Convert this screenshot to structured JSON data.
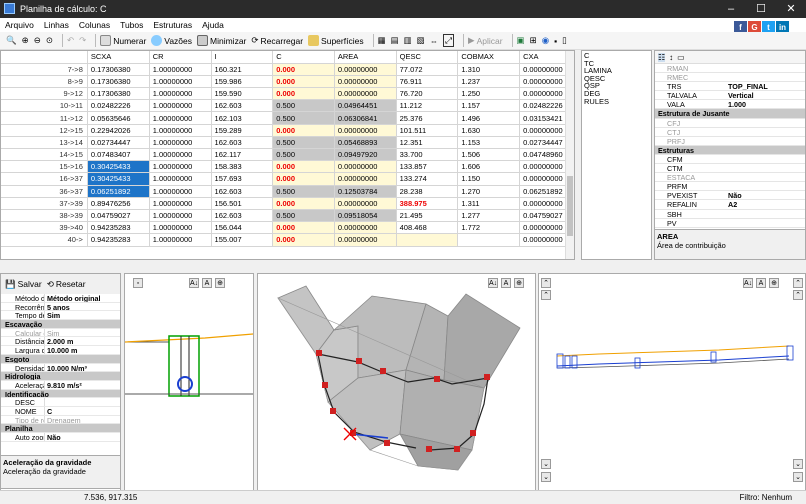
{
  "window": {
    "title": "Planilha de cálculo: C"
  },
  "menu": [
    "Arquivo",
    "Linhas",
    "Colunas",
    "Tubos",
    "Estruturas",
    "Ajuda"
  ],
  "toolbar": {
    "numerar": "Numerar",
    "vazoes": "Vazões",
    "minimizar": "Minimizar",
    "recarregar": "Recarregar",
    "superficies": "Superfícies",
    "aplicar": "Aplicar"
  },
  "grid": {
    "columns": [
      "SCXA",
      "CR",
      "I",
      "C",
      "AREA",
      "QESC",
      "COBMAX",
      "CXA"
    ],
    "rows": [
      {
        "id": "7->8",
        "scxa": "0.17306380",
        "cr": "1.00000000",
        "i": "160.321",
        "c": "0.000",
        "area": "0.00000000",
        "qesc": "77.072",
        "cobmax": "1.310",
        "cxa": "0.00000000"
      },
      {
        "id": "8->9",
        "scxa": "0.17306380",
        "cr": "1.00000000",
        "i": "159.986",
        "c": "0.000",
        "area": "0.00000000",
        "qesc": "76.911",
        "cobmax": "1.237",
        "cxa": "0.00000000"
      },
      {
        "id": "9->12",
        "scxa": "0.17306380",
        "cr": "1.00000000",
        "i": "159.590",
        "c": "0.000",
        "area": "0.00000000",
        "qesc": "76.720",
        "cobmax": "1.250",
        "cxa": "0.00000000"
      },
      {
        "id": "10->11",
        "scxa": "0.02482226",
        "cr": "1.00000000",
        "i": "162.603",
        "c": "0.500",
        "area": "0.04964451",
        "qesc": "11.212",
        "cobmax": "1.157",
        "cxa": "0.02482226"
      },
      {
        "id": "11->12",
        "scxa": "0.05635646",
        "cr": "1.00000000",
        "i": "162.103",
        "c": "0.500",
        "area": "0.06306841",
        "qesc": "25.376",
        "cobmax": "1.496",
        "cxa": "0.03153421"
      },
      {
        "id": "12->15",
        "scxa": "0.22942026",
        "cr": "1.00000000",
        "i": "159.289",
        "c": "0.000",
        "area": "0.00000000",
        "qesc": "101.511",
        "cobmax": "1.630",
        "cxa": "0.00000000"
      },
      {
        "id": "13->14",
        "scxa": "0.02734447",
        "cr": "1.00000000",
        "i": "162.603",
        "c": "0.500",
        "area": "0.05468893",
        "qesc": "12.351",
        "cobmax": "1.153",
        "cxa": "0.02734447"
      },
      {
        "id": "14->15",
        "scxa": "0.07483407",
        "cr": "1.00000000",
        "i": "162.117",
        "c": "0.500",
        "area": "0.09497920",
        "qesc": "33.700",
        "cobmax": "1.506",
        "cxa": "0.04748960"
      },
      {
        "id": "15->16",
        "scxa": "0.30425433",
        "cr": "1.00000000",
        "i": "158.383",
        "c": "0.000",
        "area": "0.00000000",
        "qesc": "133.857",
        "cobmax": "1.606",
        "cxa": "0.00000000"
      },
      {
        "id": "16->37",
        "scxa": "0.30425433",
        "cr": "1.00000000",
        "i": "157.693",
        "c": "0.000",
        "area": "0.00000000",
        "qesc": "133.274",
        "cobmax": "1.150",
        "cxa": "0.00000000"
      },
      {
        "id": "36->37",
        "scxa": "0.06251892",
        "cr": "1.00000000",
        "i": "162.603",
        "c": "0.500",
        "area": "0.12503784",
        "qesc": "28.238",
        "cobmax": "1.270",
        "cxa": "0.06251892"
      },
      {
        "id": "37->39",
        "scxa": "0.89476256",
        "cr": "1.00000000",
        "i": "156.501",
        "c": "0.000",
        "area": "0.00000000",
        "qesc": "388.975",
        "cobmax": "1.311",
        "cxa": "0.00000000"
      },
      {
        "id": "38->39",
        "scxa": "0.04759027",
        "cr": "1.00000000",
        "i": "162.603",
        "c": "0.500",
        "area": "0.09518054",
        "qesc": "21.495",
        "cobmax": "1.277",
        "cxa": "0.04759027"
      },
      {
        "id": "39->40",
        "scxa": "0.94235283",
        "cr": "1.00000000",
        "i": "156.044",
        "c": "0.000",
        "area": "0.00000000",
        "qesc": "408.468",
        "cobmax": "1.772",
        "cxa": "0.00000000"
      },
      {
        "id": "40->",
        "scxa": "0.94235283",
        "cr": "1.00000000",
        "i": "155.007",
        "c": "0.000",
        "area": "0.00000000",
        "qesc": "",
        "cobmax": "",
        "cxa": "0.00000000"
      }
    ]
  },
  "listbox": [
    "C",
    "TC",
    "LAMINA",
    "QESC",
    "QSP",
    "DEG",
    "RULES"
  ],
  "props": {
    "rows": [
      {
        "k": "RMAN",
        "v": "",
        "dim": true
      },
      {
        "k": "RMEC",
        "v": "",
        "dim": true
      },
      {
        "k": "TRS",
        "v": "TOP_FINAL"
      },
      {
        "k": "TALVALA",
        "v": "Vertical"
      },
      {
        "k": "VALA",
        "v": "1.000"
      },
      {
        "cat": "Estrutura de Jusante"
      },
      {
        "k": "CFJ",
        "v": "",
        "dim": true
      },
      {
        "k": "CTJ",
        "v": "",
        "dim": true
      },
      {
        "k": "PRFJ",
        "v": "",
        "dim": true
      },
      {
        "cat": "Estruturas"
      },
      {
        "k": "CFM",
        "v": ""
      },
      {
        "k": "CTM",
        "v": ""
      },
      {
        "k": "ESTACA",
        "v": "",
        "dim": true
      },
      {
        "k": "PRFM",
        "v": ""
      },
      {
        "k": "PVEXIST",
        "v": "Não"
      },
      {
        "k": "REFALIN",
        "v": "A2"
      },
      {
        "k": "SBH",
        "v": ""
      },
      {
        "k": "PV",
        "v": ""
      }
    ],
    "desc_title": "AREA",
    "desc_text": "Área de contribuição"
  },
  "left": {
    "save": "Salvar",
    "reset": "Resetar",
    "rows": [
      {
        "k": "Método de cá",
        "v": "Método original"
      },
      {
        "k": "Recorrência",
        "v": "5 anos"
      },
      {
        "k": "Tempo de rec",
        "v": "Sim"
      },
      {
        "cat": "Escavação"
      },
      {
        "k": "Calcular esco",
        "v": "Sim",
        "dim": true
      },
      {
        "k": "Distância ent",
        "v": "2.000 m"
      },
      {
        "k": "Largura da se",
        "v": "10.000 m"
      },
      {
        "cat": "Esgoto"
      },
      {
        "k": "Densidade",
        "v": "10.000 N/m³"
      },
      {
        "cat": "Hidrologia"
      },
      {
        "k": "Aceleração d",
        "v": "9.810 m/s²"
      },
      {
        "cat": "Identificação"
      },
      {
        "k": "DESC",
        "v": ""
      },
      {
        "k": "NOME",
        "v": "C"
      },
      {
        "k": "Tipo de rede",
        "v": "Drenagem",
        "dim": true
      },
      {
        "cat": "Planilha"
      },
      {
        "k": "Auto zoom",
        "v": "Não"
      }
    ],
    "desc_title": "Aceleração da gravidade",
    "desc_text": "Aceleração da gravidade"
  },
  "status": {
    "coords": "7.536, 917.315",
    "filter": "Filtro:  Nenhum"
  },
  "colors": {
    "selection": "#1e74c8",
    "red_value": "#e00000",
    "yellow_cell": "#fff9d6"
  }
}
